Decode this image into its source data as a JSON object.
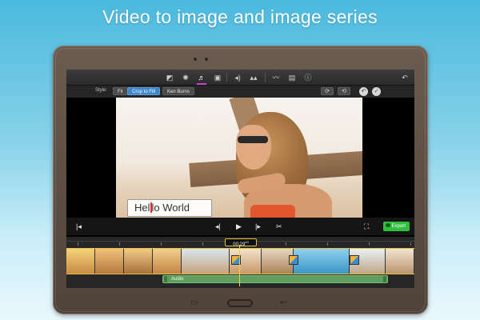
{
  "headline": "Video to image and image series",
  "toolbar": {
    "icons": [
      "crop-icon",
      "color-icon",
      "adjust-icon",
      "stabilize-icon",
      "volume-icon",
      "equalizer-icon",
      "speed-icon",
      "clip-filter-icon",
      "info-icon",
      "undo-icon"
    ]
  },
  "stylebar": {
    "label": "Style:",
    "options": [
      "Fit",
      "Crop to Fill",
      "Ken Burns"
    ],
    "selected": "Crop to Fill"
  },
  "overlay_text": {
    "before_caret": "Hel",
    "after_caret": "lo World"
  },
  "timeline": {
    "timecode": "00:29",
    "timecode_sup": "49",
    "audio_label": "Audio"
  },
  "playbar": {
    "export_label": "Export"
  },
  "colors": {
    "accent_selected": "#3f86c8",
    "export_green": "#2fbf3c",
    "timeline_border": "#e6c23a",
    "audio_green": "#5e9e5e"
  }
}
